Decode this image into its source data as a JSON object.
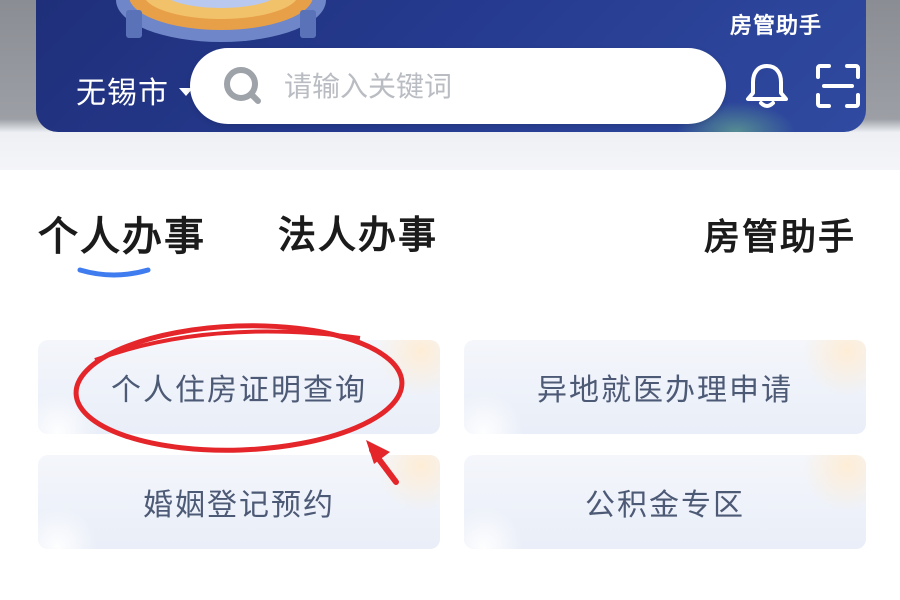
{
  "header": {
    "brand_small": "房管助手",
    "city": "无锡市",
    "search": {
      "placeholder": "请输入关键词"
    },
    "icons": [
      "search-icon",
      "bell-icon",
      "scan-icon",
      "chevron-down-icon"
    ]
  },
  "tabs": {
    "items": [
      {
        "label": "个人办事",
        "active": true
      },
      {
        "label": "法人办事",
        "active": false
      }
    ],
    "brand_large": "房管助手"
  },
  "services": [
    {
      "label": "个人住房证明查询",
      "highlighted": true
    },
    {
      "label": "异地就医办理申请"
    },
    {
      "label": "婚姻登记预约"
    },
    {
      "label": "公积金专区"
    }
  ],
  "colors": {
    "banner": "#253a8e",
    "tab_underline": "#3f7cf0",
    "annotation": "#e4252a",
    "card_text": "#4d5a76"
  }
}
